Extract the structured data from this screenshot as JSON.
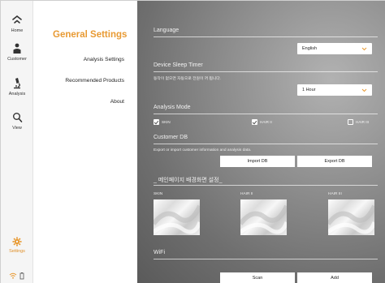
{
  "rail": {
    "items": [
      {
        "label": "Home"
      },
      {
        "label": "Customer"
      },
      {
        "label": "Analysis"
      },
      {
        "label": "View"
      }
    ],
    "settings": {
      "label": "Settings"
    }
  },
  "menu": {
    "title": "General Settings",
    "items": [
      "Analysis Settings",
      "Recommended Products",
      "About"
    ]
  },
  "language": {
    "title": "Language",
    "value": "English"
  },
  "sleep": {
    "title": "Device Sleep Timer",
    "note": "동작이 없으면 자동으로 전원이 꺼 됩니다.",
    "value": "1 Hour"
  },
  "analysis_mode": {
    "title": "Analysis Mode",
    "options": [
      {
        "label": "SKIN",
        "checked": true
      },
      {
        "label": "HAIR II",
        "checked": true
      },
      {
        "label": "HAIR III",
        "checked": false
      }
    ]
  },
  "customer_db": {
    "title": "Customer DB",
    "note": "Export or import customer information and analysis data.",
    "import_label": "Import DB",
    "export_label": "Export DB"
  },
  "main_bg": {
    "title": "_ 메인페이지 배경화면 설정_",
    "labels": [
      "SKIN",
      "HAIR II",
      "HAIR III"
    ]
  },
  "wifi": {
    "title": "WiFi",
    "scan_label": "Scan",
    "add_label": "Add"
  },
  "colors": {
    "accent": "#e89a33",
    "panel_bg": "#8e8e8e"
  }
}
